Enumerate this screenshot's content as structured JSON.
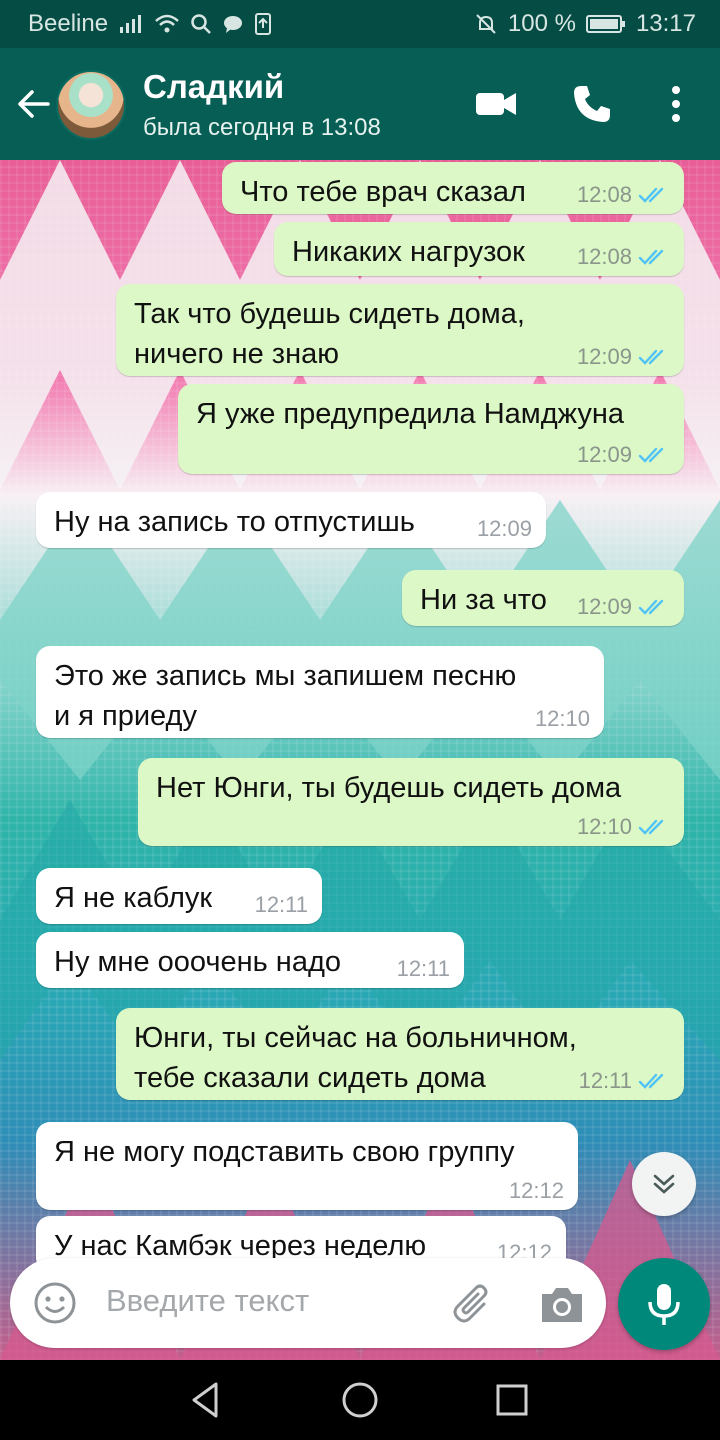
{
  "status_bar": {
    "carrier": "Beeline",
    "battery": "100 %",
    "time": "13:17",
    "icons": [
      "signal-icon",
      "wifi-icon",
      "search-icon",
      "chat-bubble-icon",
      "upload-icon",
      "mute-icon",
      "battery-icon"
    ]
  },
  "header": {
    "contact_name": "Сладкий",
    "last_seen": "была сегодня в 13:08",
    "icons": [
      "back-arrow-icon",
      "video-call-icon",
      "phone-icon",
      "more-vert-icon"
    ]
  },
  "messages": [
    {
      "dir": "out",
      "text": "Что тебе врач сказал",
      "time": "12:08",
      "read": true
    },
    {
      "dir": "out",
      "text": "Никаких нагрузок",
      "time": "12:08",
      "read": true
    },
    {
      "dir": "out",
      "text": "Так что будешь сидеть дома,\nничего не знаю",
      "time": "12:09",
      "read": true
    },
    {
      "dir": "out",
      "text": "Я уже предупредила Намджуна",
      "time": "12:09",
      "read": true
    },
    {
      "dir": "in",
      "text": "Ну на запись то отпустишь",
      "time": "12:09"
    },
    {
      "dir": "out",
      "text": "Ни за что",
      "time": "12:09",
      "read": true
    },
    {
      "dir": "in",
      "text": "Это же запись мы запишем песню\nи я приеду",
      "time": "12:10"
    },
    {
      "dir": "out",
      "text": "Нет Юнги, ты будешь сидеть дома",
      "time": "12:10",
      "read": true
    },
    {
      "dir": "in",
      "text": "Я не каблук",
      "time": "12:11"
    },
    {
      "dir": "in",
      "text": "Ну мне ооочень надо",
      "time": "12:11"
    },
    {
      "dir": "out",
      "text": "Юнги, ты сейчас на больничном,\nтебе сказали сидеть дома",
      "time": "12:11",
      "read": true
    },
    {
      "dir": "in",
      "text": "Я не могу подставить свою группу",
      "time": "12:12"
    },
    {
      "dir": "in",
      "text": "У нас Камбэк через неделю",
      "time": "12:12"
    }
  ],
  "composer": {
    "placeholder": "Введите текст",
    "icons": [
      "emoji-icon",
      "paperclip-icon",
      "camera-icon",
      "mic-icon"
    ]
  },
  "colors": {
    "header": "#075e54",
    "status_bar": "#054d44",
    "outgoing_bubble": "#dcf8c6",
    "incoming_bubble": "#ffffff",
    "read_ticks": "#4fc3f7",
    "mic_button": "#00897b"
  }
}
